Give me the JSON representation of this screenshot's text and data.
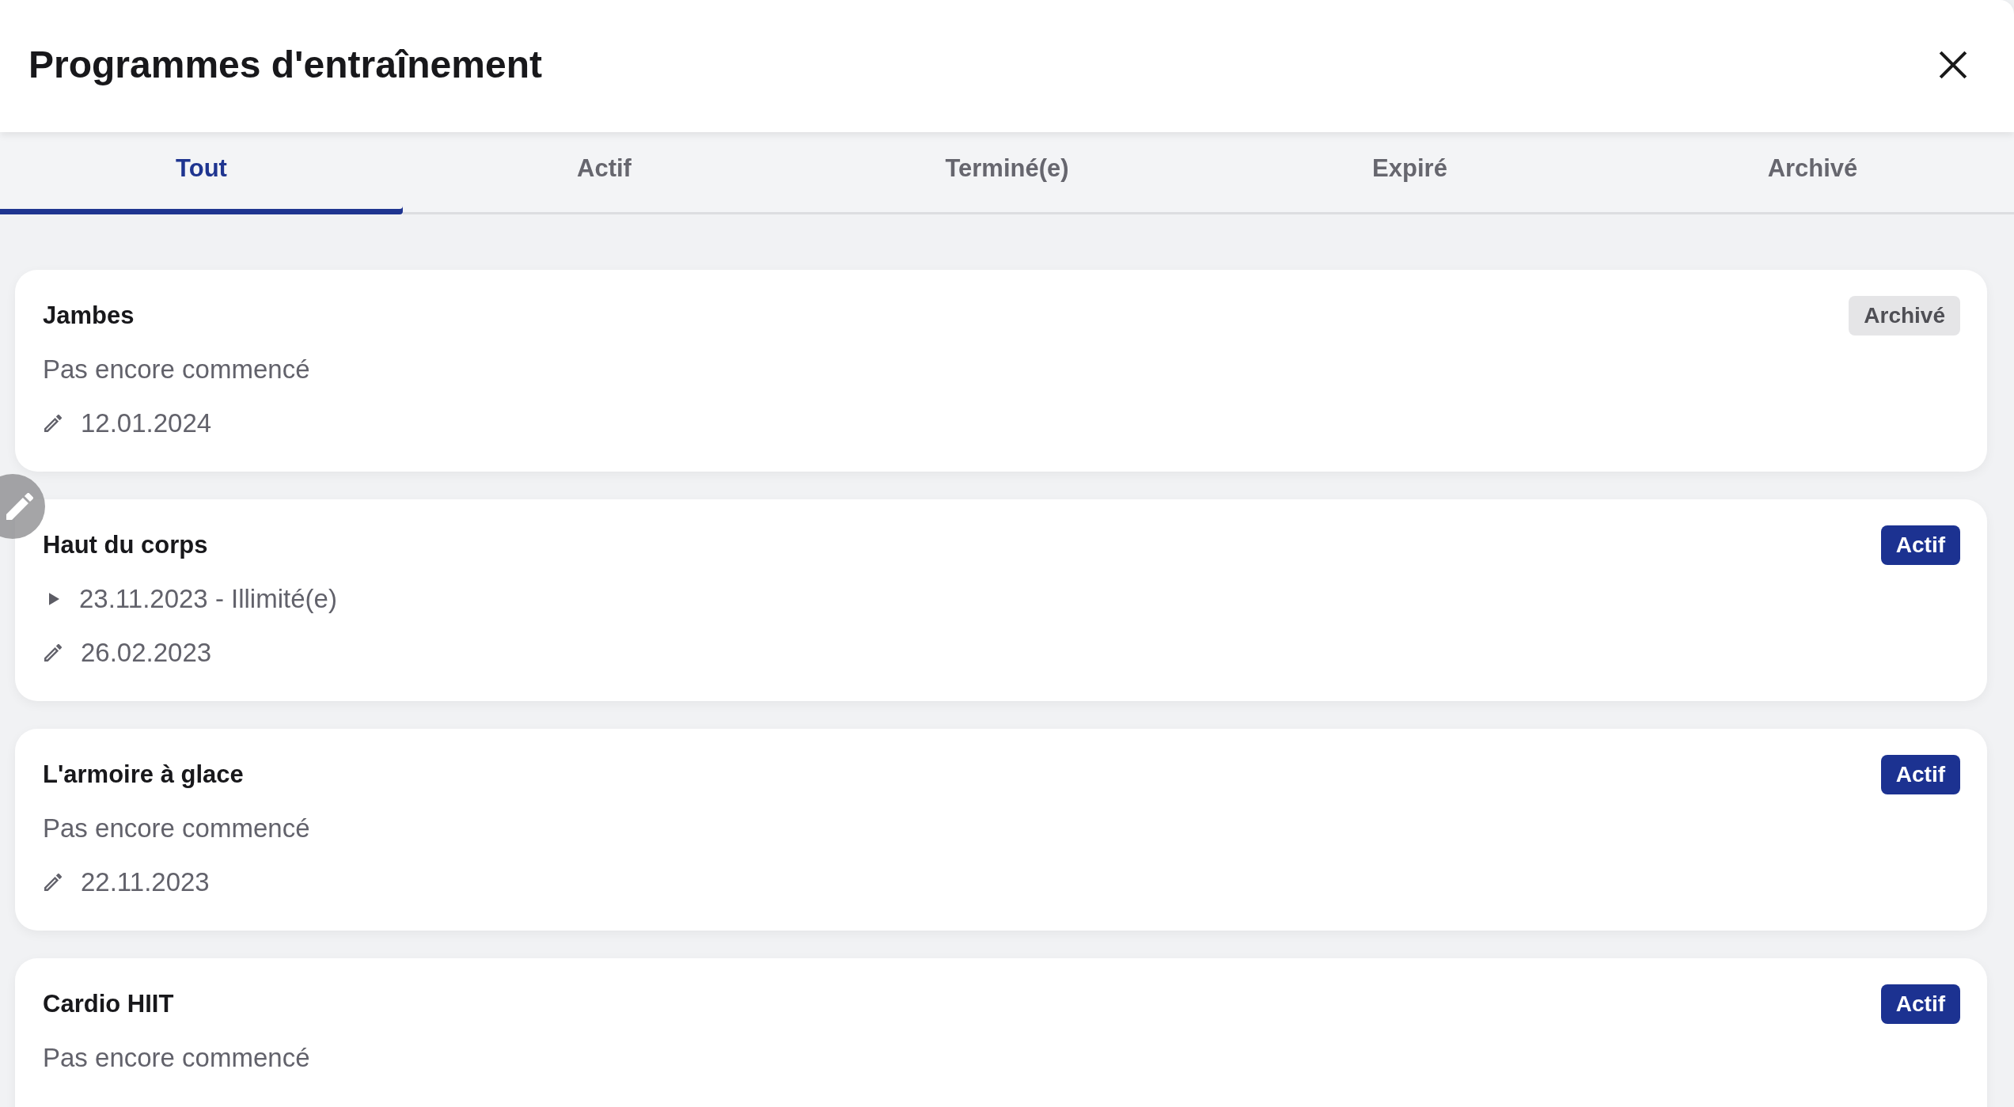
{
  "dialog": {
    "title": "Programmes d'entraînement"
  },
  "tabs": [
    {
      "label": "Tout",
      "selected": true
    },
    {
      "label": "Actif",
      "selected": false
    },
    {
      "label": "Terminé(e)",
      "selected": false
    },
    {
      "label": "Expiré",
      "selected": false
    },
    {
      "label": "Archivé",
      "selected": false
    }
  ],
  "programs": [
    {
      "name": "Jambes",
      "badge": {
        "label": "Archivé",
        "kind": "archived"
      },
      "details": [
        {
          "kind": "note",
          "text": "Pas encore commencé"
        },
        {
          "kind": "edited",
          "text": "12.01.2024"
        }
      ]
    },
    {
      "name": "Haut du corps",
      "badge": {
        "label": "Actif",
        "kind": "active"
      },
      "details": [
        {
          "kind": "period",
          "text": "23.11.2023 - Illimité(e)"
        },
        {
          "kind": "edited",
          "text": "26.02.2023"
        }
      ]
    },
    {
      "name": "L'armoire à glace",
      "badge": {
        "label": "Actif",
        "kind": "active"
      },
      "details": [
        {
          "kind": "note",
          "text": "Pas encore commencé"
        },
        {
          "kind": "edited",
          "text": "22.11.2023"
        }
      ]
    },
    {
      "name": "Cardio HIIT",
      "badge": {
        "label": "Actif",
        "kind": "active"
      },
      "details": [
        {
          "kind": "note",
          "text": "Pas encore commencé"
        }
      ]
    }
  ]
}
